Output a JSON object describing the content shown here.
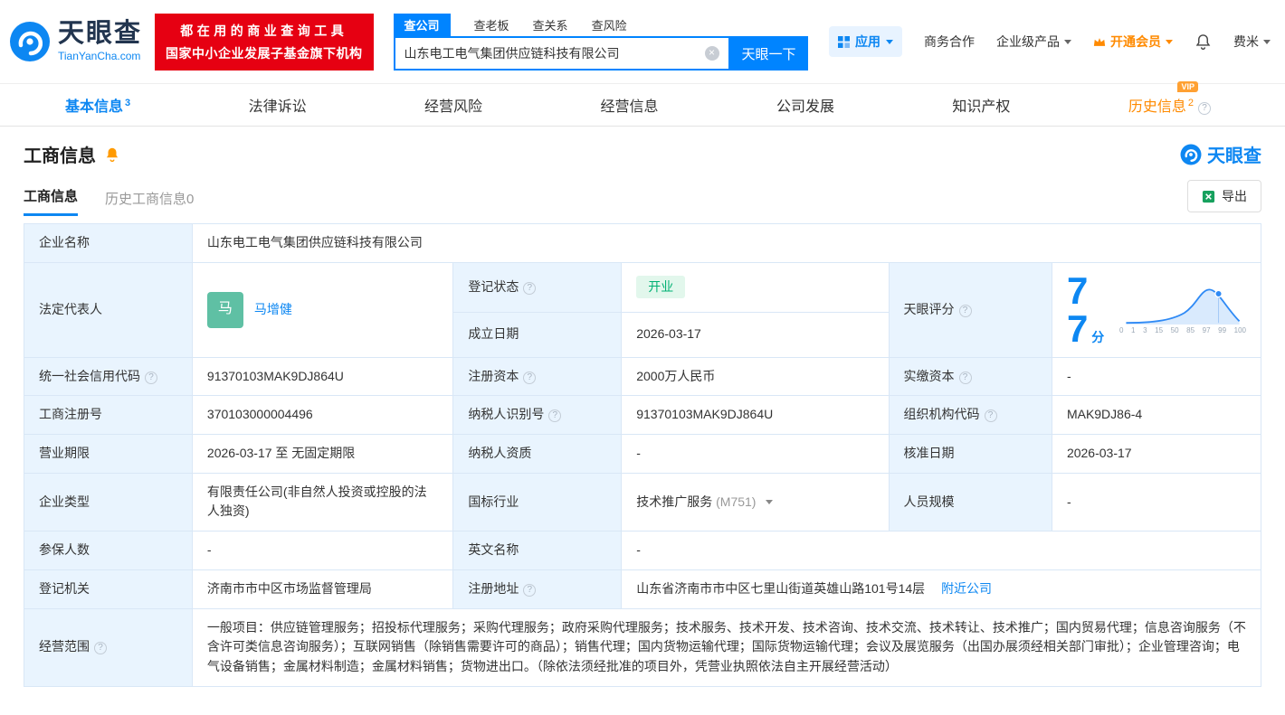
{
  "header": {
    "logo": {
      "title": "天眼查",
      "subtitle": "TianYanCha.com"
    },
    "badge": {
      "line1": "都在用的商业查询工具",
      "line2": "国家中小企业发展子基金旗下机构"
    },
    "search": {
      "tabs": [
        {
          "label": "查公司"
        },
        {
          "label": "查老板"
        },
        {
          "label": "查关系"
        },
        {
          "label": "查风险"
        }
      ],
      "value": "山东电工电气集团供应链科技有限公司",
      "button": "天眼一下"
    },
    "right": {
      "app": "应用",
      "cooperation": "商务合作",
      "enterprise": "企业级产品",
      "vip": "开通会员",
      "user": "费米"
    }
  },
  "nav": {
    "tabs": [
      {
        "label": "基本信息",
        "count": "3"
      },
      {
        "label": "法律诉讼"
      },
      {
        "label": "经营风险"
      },
      {
        "label": "经营信息"
      },
      {
        "label": "公司发展"
      },
      {
        "label": "知识产权"
      },
      {
        "label": "历史信息",
        "count": "2",
        "badge": "VIP"
      }
    ]
  },
  "section": {
    "title": "工商信息",
    "brand": "天眼查",
    "subtabs": [
      {
        "label": "工商信息"
      },
      {
        "label": "历史工商信息0"
      }
    ],
    "export": "导出"
  },
  "table": {
    "company_name": {
      "label": "企业名称",
      "value": "山东电工电气集团供应链科技有限公司"
    },
    "legal_rep": {
      "label": "法定代表人",
      "avatar": "马",
      "value": "马增健"
    },
    "reg_status": {
      "label": "登记状态",
      "value": "开业"
    },
    "establish_date": {
      "label": "成立日期",
      "value": "2026-03-17"
    },
    "score": {
      "label": "天眼评分",
      "value": "77",
      "unit": "分",
      "axis": [
        "0",
        "1",
        "3",
        "15",
        "50",
        "85",
        "97",
        "99",
        "100"
      ]
    },
    "credit_code": {
      "label": "统一社会信用代码",
      "value": "91370103MAK9DJ864U"
    },
    "reg_capital": {
      "label": "注册资本",
      "value": "2000万人民币"
    },
    "paid_capital": {
      "label": "实缴资本",
      "value": "-"
    },
    "reg_number": {
      "label": "工商注册号",
      "value": "370103000004496"
    },
    "taxpayer_id": {
      "label": "纳税人识别号",
      "value": "91370103MAK9DJ864U"
    },
    "org_code": {
      "label": "组织机构代码",
      "value": "MAK9DJ86-4"
    },
    "business_term": {
      "label": "营业期限",
      "value": "2026-03-17 至 无固定期限"
    },
    "taxpayer_quality": {
      "label": "纳税人资质",
      "value": "-"
    },
    "approval_date": {
      "label": "核准日期",
      "value": "2026-03-17"
    },
    "company_type": {
      "label": "企业类型",
      "value": "有限责任公司(非自然人投资或控股的法人独资)"
    },
    "industry": {
      "label": "国标行业",
      "value": "技术推广服务",
      "code": "(M751)"
    },
    "staff_size": {
      "label": "人员规模",
      "value": "-"
    },
    "insured_count": {
      "label": "参保人数",
      "value": "-"
    },
    "english_name": {
      "label": "英文名称",
      "value": "-"
    },
    "reg_authority": {
      "label": "登记机关",
      "value": "济南市市中区市场监督管理局"
    },
    "reg_address": {
      "label": "注册地址",
      "value": "山东省济南市市中区七里山街道英雄山路101号14层",
      "link": "附近公司"
    },
    "business_scope": {
      "label": "经营范围",
      "value": "一般项目：供应链管理服务；招投标代理服务；采购代理服务；政府采购代理服务；技术服务、技术开发、技术咨询、技术交流、技术转让、技术推广；国内贸易代理；信息咨询服务（不含许可类信息咨询服务）；互联网销售（除销售需要许可的商品）；销售代理；国内货物运输代理；国际货物运输代理；会议及展览服务（出国办展须经相关部门审批）；企业管理咨询；电气设备销售；金属材料制造；金属材料销售；货物进出口。（除依法须经批准的项目外，凭营业执照依法自主开展经营活动）"
    }
  }
}
